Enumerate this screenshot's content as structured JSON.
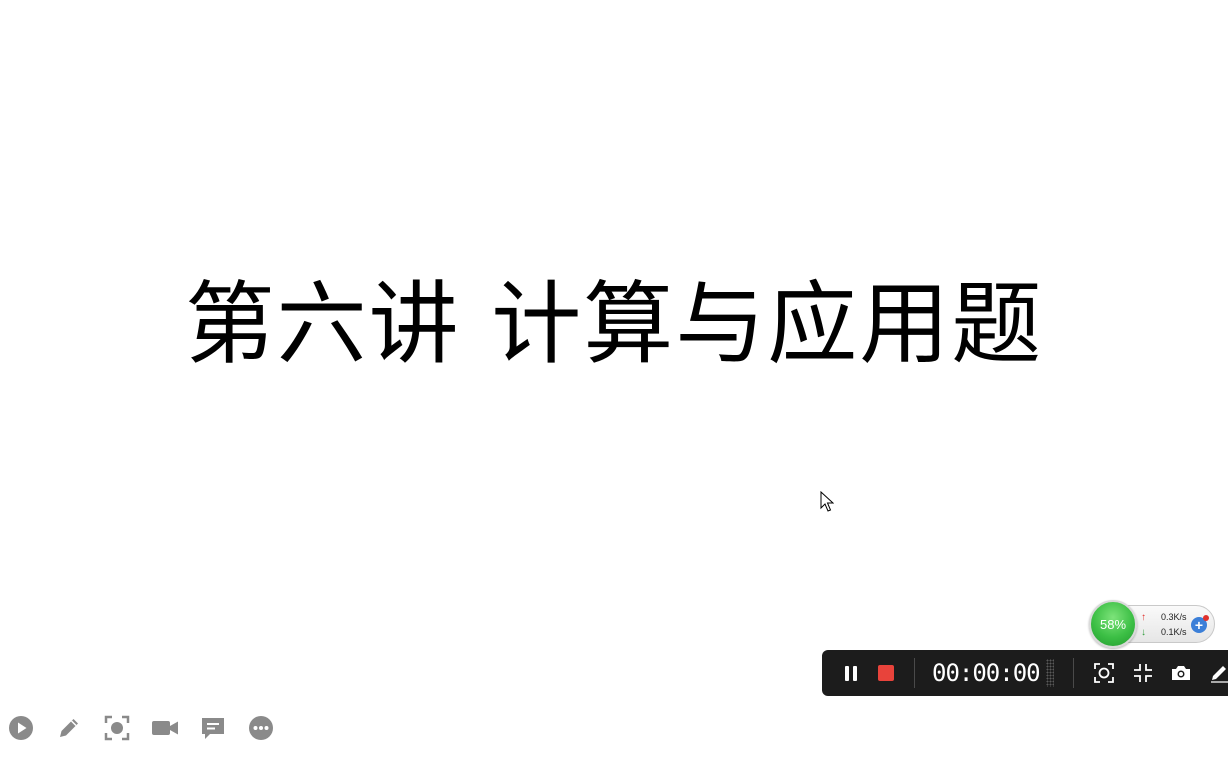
{
  "slide": {
    "title": "第六讲 计算与应用题"
  },
  "presenter_toolbar": {
    "icons": [
      "play-icon",
      "pen-icon",
      "focus-icon",
      "video-camera-icon",
      "comment-icon",
      "more-icon"
    ]
  },
  "net_widget": {
    "memory_percent": "58%",
    "upload_speed": "0.3K/s",
    "download_speed": "0.1K/s",
    "boost_label": "+"
  },
  "recording_toolbar": {
    "timer": "00:00:00",
    "stop_color": "#e8433b",
    "icons": [
      "pause-icon",
      "stop-icon",
      "region-capture-icon",
      "shrink-icon",
      "camera-icon",
      "pen-icon"
    ]
  },
  "colors": {
    "slide_background": "#ffffff",
    "toolbar_background": "#1c1c1c",
    "memory_ball": "#3cbf45",
    "presenter_icon": "#8a8a8a"
  }
}
